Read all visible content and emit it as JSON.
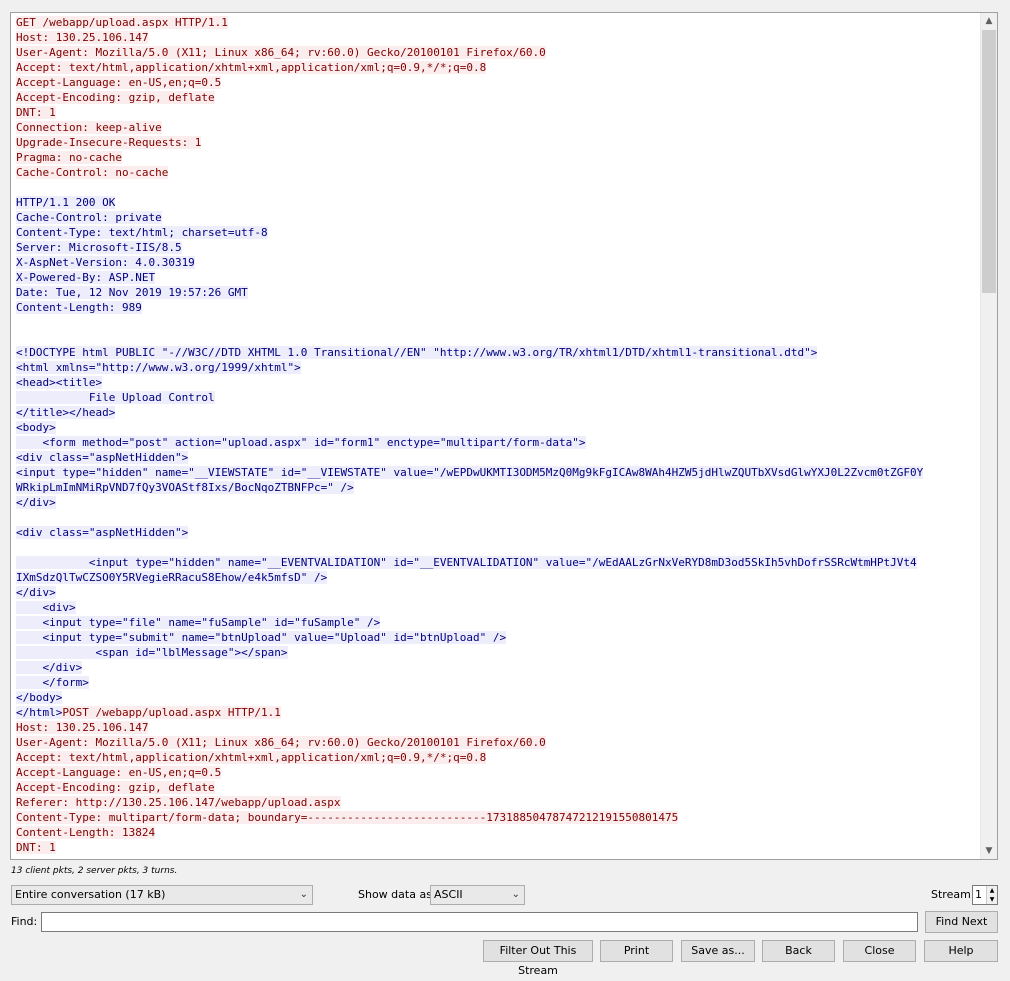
{
  "stream": {
    "lines": [
      {
        "t": "c",
        "text": "GET /webapp/upload.aspx HTTP/1.1"
      },
      {
        "t": "c",
        "text": "Host: 130.25.106.147"
      },
      {
        "t": "c",
        "text": "User-Agent: Mozilla/5.0 (X11; Linux x86_64; rv:60.0) Gecko/20100101 Firefox/60.0"
      },
      {
        "t": "c",
        "text": "Accept: text/html,application/xhtml+xml,application/xml;q=0.9,*/*;q=0.8"
      },
      {
        "t": "c",
        "text": "Accept-Language: en-US,en;q=0.5"
      },
      {
        "t": "c",
        "text": "Accept-Encoding: gzip, deflate"
      },
      {
        "t": "c",
        "text": "DNT: 1"
      },
      {
        "t": "c",
        "text": "Connection: keep-alive"
      },
      {
        "t": "c",
        "text": "Upgrade-Insecure-Requests: 1"
      },
      {
        "t": "c",
        "text": "Pragma: no-cache"
      },
      {
        "t": "c",
        "text": "Cache-Control: no-cache"
      },
      {
        "t": "c",
        "text": ""
      },
      {
        "t": "s",
        "text": "HTTP/1.1 200 OK"
      },
      {
        "t": "s",
        "text": "Cache-Control: private"
      },
      {
        "t": "s",
        "text": "Content-Type: text/html; charset=utf-8"
      },
      {
        "t": "s",
        "text": "Server: Microsoft-IIS/8.5"
      },
      {
        "t": "s",
        "text": "X-AspNet-Version: 4.0.30319"
      },
      {
        "t": "s",
        "text": "X-Powered-By: ASP.NET"
      },
      {
        "t": "s",
        "text": "Date: Tue, 12 Nov 2019 19:57:26 GMT"
      },
      {
        "t": "s",
        "text": "Content-Length: 989"
      },
      {
        "t": "s",
        "text": ""
      },
      {
        "t": "s",
        "text": ""
      },
      {
        "t": "s",
        "text": "<!DOCTYPE html PUBLIC \"-//W3C//DTD XHTML 1.0 Transitional//EN\" \"http://www.w3.org/TR/xhtml1/DTD/xhtml1-transitional.dtd\">"
      },
      {
        "t": "s",
        "text": "<html xmlns=\"http://www.w3.org/1999/xhtml\">"
      },
      {
        "t": "s",
        "text": "<head><title>"
      },
      {
        "t": "s",
        "text": "           File Upload Control"
      },
      {
        "t": "s",
        "text": "</title></head>"
      },
      {
        "t": "s",
        "text": "<body>"
      },
      {
        "t": "s",
        "text": "    <form method=\"post\" action=\"upload.aspx\" id=\"form1\" enctype=\"multipart/form-data\">"
      },
      {
        "t": "s",
        "text": "<div class=\"aspNetHidden\">"
      },
      {
        "t": "s",
        "text": "<input type=\"hidden\" name=\"__VIEWSTATE\" id=\"__VIEWSTATE\" value=\"/wEPDwUKMTI3ODM5MzQ0Mg9kFgICAw8WAh4HZW5jdHlwZQUTbXVsdGlwYXJ0L2Zvcm0tZGF0Y"
      },
      {
        "t": "s",
        "text": "WRkipLmImNMiRpVND7fQy3VOAStf8Ixs/BocNqoZTBNFPc=\" />"
      },
      {
        "t": "s",
        "text": "</div>"
      },
      {
        "t": "s",
        "text": ""
      },
      {
        "t": "s",
        "text": "<div class=\"aspNetHidden\">"
      },
      {
        "t": "s",
        "text": ""
      },
      {
        "t": "s",
        "text": "           <input type=\"hidden\" name=\"__EVENTVALIDATION\" id=\"__EVENTVALIDATION\" value=\"/wEdAALzGrNxVeRYD8mD3od5SkIh5vhDofrSSRcWtmHPtJVt4"
      },
      {
        "t": "s",
        "text": "IXmSdzQlTwCZSO0Y5RVegieRRacuS8Ehow/e4k5mfsD\" />"
      },
      {
        "t": "s",
        "text": "</div>"
      },
      {
        "t": "s",
        "text": "    <div>"
      },
      {
        "t": "s",
        "text": "    <input type=\"file\" name=\"fuSample\" id=\"fuSample\" />"
      },
      {
        "t": "s",
        "text": "    <input type=\"submit\" name=\"btnUpload\" value=\"Upload\" id=\"btnUpload\" />"
      },
      {
        "t": "s",
        "text": "            <span id=\"lblMessage\"></span>"
      },
      {
        "t": "s",
        "text": "    </div>"
      },
      {
        "t": "s",
        "text": "    </form>"
      },
      {
        "t": "s",
        "text": "</body>"
      },
      {
        "t": "mix",
        "text": "</html>",
        "text2": "POST /webapp/upload.aspx HTTP/1.1"
      },
      {
        "t": "c",
        "text": "Host: 130.25.106.147"
      },
      {
        "t": "c",
        "text": "User-Agent: Mozilla/5.0 (X11; Linux x86_64; rv:60.0) Gecko/20100101 Firefox/60.0"
      },
      {
        "t": "c",
        "text": "Accept: text/html,application/xhtml+xml,application/xml;q=0.9,*/*;q=0.8"
      },
      {
        "t": "c",
        "text": "Accept-Language: en-US,en;q=0.5"
      },
      {
        "t": "c",
        "text": "Accept-Encoding: gzip, deflate"
      },
      {
        "t": "c",
        "text": "Referer: http://130.25.106.147/webapp/upload.aspx"
      },
      {
        "t": "c",
        "text": "Content-Type: multipart/form-data; boundary=---------------------------17318850478747212191550801475"
      },
      {
        "t": "c",
        "text": "Content-Length: 13824"
      },
      {
        "t": "c",
        "text": "DNT: 1"
      }
    ]
  },
  "stats": "13 client pkts, 2 server pkts, 3 turns.",
  "conversation_select": "Entire conversation (17 kB)",
  "show_data_label": "Show data as",
  "show_data_value": "ASCII",
  "stream_label": "Stream",
  "stream_value": "1",
  "find_label": "Find:",
  "find_value": "",
  "buttons": {
    "find_next": "Find Next",
    "filter_out": "Filter Out This Stream",
    "print": "Print",
    "save_as": "Save as...",
    "back": "Back",
    "close": "Close",
    "help": "Help"
  },
  "colors": {
    "client_bg": "#fbeded",
    "client_fg": "#800000",
    "server_bg": "#ededfb",
    "server_fg": "#000080"
  }
}
